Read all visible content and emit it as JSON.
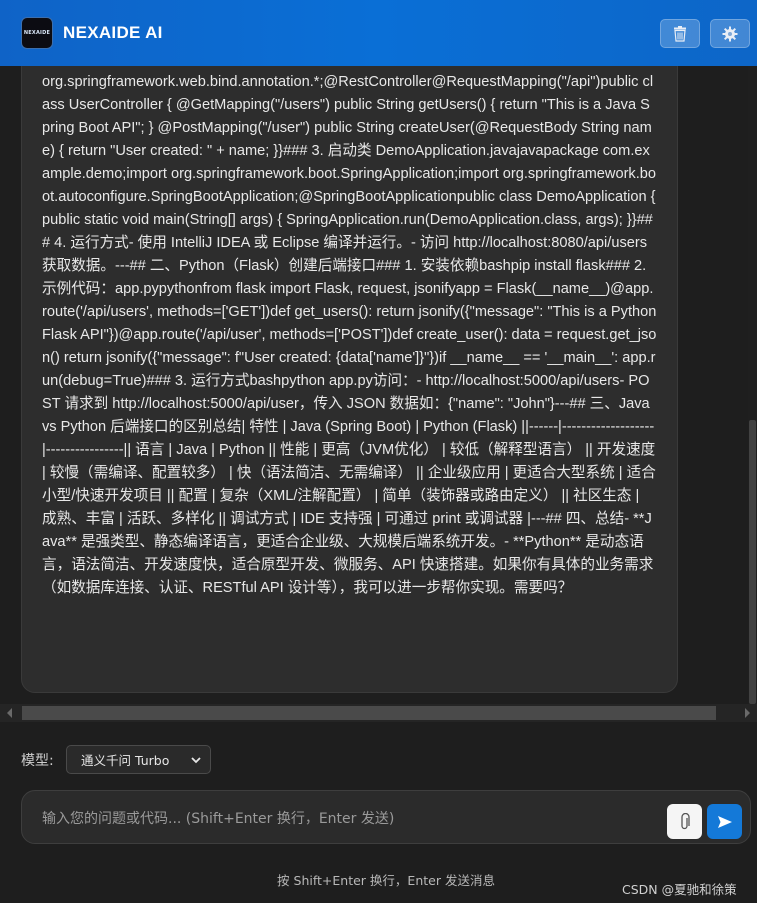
{
  "header": {
    "logo_text": "NEXAIDE",
    "title": "NEXAIDE AI",
    "clear_icon": "trash-icon",
    "settings_icon": "gear-icon"
  },
  "chat": {
    "message_text": "org.springframework.web.bind.annotation.*;@RestController@RequestMapping(\"/api\")public class UserController { @GetMapping(\"/users\") public String getUsers() { return \"This is a Java Spring Boot API\"; } @PostMapping(\"/user\") public String createUser(@RequestBody String name) { return \"User created: \" + name; }}### 3. 启动类 DemoApplication.javajavapackage com.example.demo;import org.springframework.boot.SpringApplication;import org.springframework.boot.autoconfigure.SpringBootApplication;@SpringBootApplicationpublic class DemoApplication { public static void main(String[] args) { SpringApplication.run(DemoApplication.class, args); }}### 4. 运行方式- 使用 IntelliJ IDEA 或 Eclipse 编译并运行。- 访问 http://localhost:8080/api/users 获取数据。---## 二、Python（Flask）创建后端接口### 1. 安装依赖bashpip install flask### 2. 示例代码：app.pypythonfrom flask import Flask, request, jsonifyapp = Flask(__name__)@app.route('/api/users', methods=['GET'])def get_users(): return jsonify({\"message\": \"This is a Python Flask API\"})@app.route('/api/user', methods=['POST'])def create_user(): data = request.get_json() return jsonify({\"message\": f\"User created: {data['name']}\"})if __name__ == '__main__': app.run(debug=True)### 3. 运行方式bashpython app.py访问：- http://localhost:5000/api/users- POST 请求到 http://localhost:5000/api/user，传入 JSON 数据如：{\"name\": \"John\"}---## 三、Java vs Python 后端接口的区别总结| 特性 | Java (Spring Boot) | Python (Flask) ||------|-------------------|----------------|| 语言 | Java | Python || 性能 | 更高（JVM优化） | 较低（解释型语言） || 开发速度 | 较慢（需编译、配置较多） | 快（语法简洁、无需编译） || 企业级应用 | 更适合大型系统 | 适合小型/快速开发项目 || 配置 | 复杂（XML/注解配置） | 简单（装饰器或路由定义） || 社区生态 | 成熟、丰富 | 活跃、多样化 || 调试方式 | IDE 支持强 | 可通过 print 或调试器 |---## 四、总结- **Java** 是强类型、静态编译语言，更适合企业级、大规模后端系统开发。- **Python** 是动态语言，语法简洁、开发速度快，适合原型开发、微服务、API 快速搭建。如果你有具体的业务需求（如数据库连接、认证、RESTful API 设计等），我可以进一步帮你实现。需要吗？"
  },
  "model": {
    "label": "模型:",
    "selected": "通义千问 Turbo"
  },
  "input": {
    "placeholder": "输入您的问题或代码... (Shift+Enter 换行，Enter 发送)",
    "attach_icon": "paperclip-icon",
    "send_icon": "send-icon"
  },
  "footer": {
    "hint": "按 Shift+Enter 换行，Enter 发送消息",
    "watermark": "CSDN @夏驰和徐策"
  },
  "colors": {
    "header_blue": "#0a6fd6",
    "send_blue": "#1479d8",
    "background": "#1e1e1e",
    "bubble": "#2d2d2d"
  }
}
